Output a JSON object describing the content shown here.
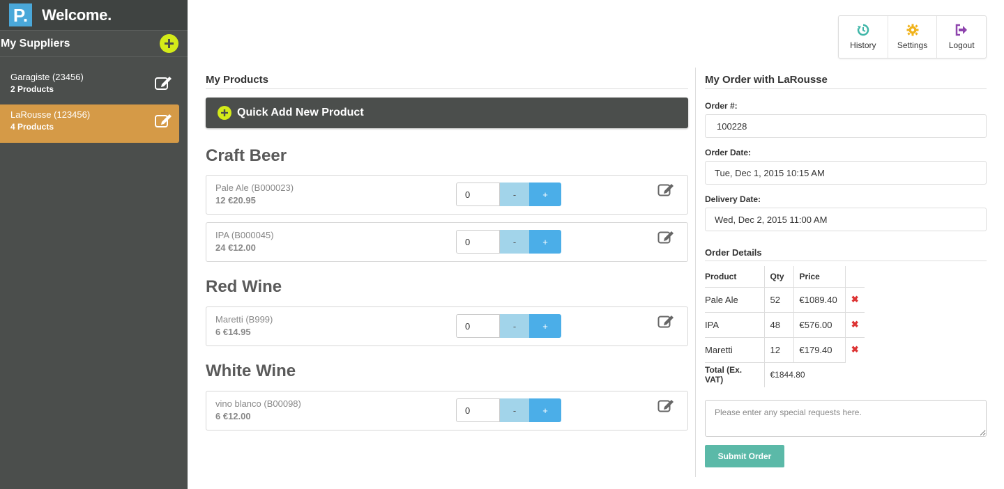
{
  "brand": {
    "logo_letter": "P.",
    "title": "Welcome."
  },
  "sidebar": {
    "header": "My Suppliers",
    "suppliers": [
      {
        "name": "Garagiste (23456)",
        "count": "2 Products",
        "selected": false
      },
      {
        "name": "LaRousse (123456)",
        "count": "4 Products",
        "selected": true
      }
    ]
  },
  "nav": {
    "items": [
      {
        "label": "History",
        "icon": "history-icon",
        "color": "#3fb6a8"
      },
      {
        "label": "Settings",
        "icon": "gear-icon",
        "color": "#f0b21a"
      },
      {
        "label": "Logout",
        "icon": "logout-icon",
        "color": "#8e44ad"
      }
    ]
  },
  "products": {
    "title": "My Products",
    "quick_add": "Quick Add New Product",
    "categories": [
      {
        "name": "Craft Beer",
        "items": [
          {
            "name": "Pale Ale (B000023)",
            "price": "12 €20.95",
            "qty": "0"
          },
          {
            "name": "IPA (B000045)",
            "price": "24 €12.00",
            "qty": "0"
          }
        ]
      },
      {
        "name": "Red Wine",
        "items": [
          {
            "name": "Maretti (B999)",
            "price": "6 €14.95",
            "qty": "0"
          }
        ]
      },
      {
        "name": "White Wine",
        "items": [
          {
            "name": "vino blanco (B00098)",
            "price": "6 €12.00",
            "qty": "0"
          }
        ]
      }
    ],
    "minus_label": "-",
    "plus_label": "+"
  },
  "order": {
    "title": "My Order with LaRousse",
    "order_no_label": "Order #:",
    "order_no": "100228",
    "order_date_label": "Order Date:",
    "order_date": "Tue, Dec 1, 2015 10:15 AM",
    "delivery_date_label": "Delivery Date:",
    "delivery_date": "Wed, Dec 2, 2015 11:00 AM",
    "details_title": "Order Details",
    "columns": [
      "Product",
      "Qty",
      "Price"
    ],
    "rows": [
      {
        "product": "Pale Ale",
        "qty": "52",
        "price": "€1089.40"
      },
      {
        "product": "IPA",
        "qty": "48",
        "price": "€576.00"
      },
      {
        "product": "Maretti",
        "qty": "12",
        "price": "€179.40"
      }
    ],
    "delete_symbol": "✖",
    "total_label": "Total (Ex. VAT)",
    "total": "€1844.80",
    "special_placeholder": "Please enter any special requests here.",
    "submit_label": "Submit Order"
  }
}
